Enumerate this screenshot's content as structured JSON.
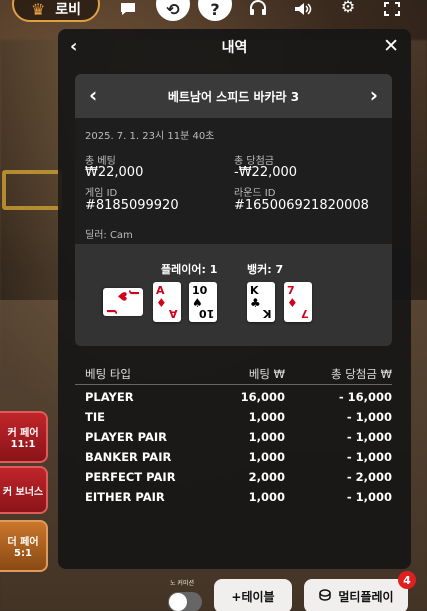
{
  "topbar": {
    "lobby_label": "로비",
    "icons": [
      "crown-icon",
      "chat-icon",
      "history-icon",
      "help-icon",
      "headset-icon",
      "volume-icon",
      "settings-icon",
      "fullscreen-icon"
    ]
  },
  "side_bets": {
    "item1_label": "커 페어",
    "item1_odds": "11:1",
    "item2_label": "커 보너스",
    "item3_label": "더 페어",
    "item3_odds": "5:1"
  },
  "panel": {
    "title": "내역",
    "game_name": "베트남어 스피드 바카라 3",
    "timestamp": "2025. 7. 1. 23시 11분 40초",
    "total_bet_label": "총 베팅",
    "total_bet_value": "₩22,000",
    "total_win_label": "총 당첨금",
    "total_win_value": "-₩22,000",
    "game_id_label": "게임 ID",
    "game_id_value": "#8185099920",
    "round_id_label": "라운드 ID",
    "round_id_value": "#165006921820008",
    "dealer_text": "딜러: Cam",
    "player_label": "플레이어: 1",
    "banker_label": "뱅커: 7",
    "player_cards": [
      {
        "rank": "J",
        "suit": "♥",
        "color": "#d0021b"
      },
      {
        "rank": "A",
        "suit": "♦",
        "color": "#d0021b"
      },
      {
        "rank": "10",
        "suit": "♠",
        "color": "#000000"
      }
    ],
    "banker_cards": [
      {
        "rank": "K",
        "suit": "♣",
        "color": "#000000"
      },
      {
        "rank": "7",
        "suit": "♦",
        "color": "#d0021b"
      }
    ],
    "bets_header": {
      "type": "베팅 타입",
      "bet": "베팅 ₩",
      "win": "총 당첨금 ₩"
    },
    "bets": [
      {
        "type": "PLAYER",
        "bet": "16,000",
        "win": "- 16,000"
      },
      {
        "type": "TIE",
        "bet": "1,000",
        "win": "- 1,000"
      },
      {
        "type": "PLAYER PAIR",
        "bet": "1,000",
        "win": "- 1,000"
      },
      {
        "type": "BANKER PAIR",
        "bet": "1,000",
        "win": "- 1,000"
      },
      {
        "type": "PERFECT PAIR",
        "bet": "2,000",
        "win": "- 2,000"
      },
      {
        "type": "EITHER PAIR",
        "bet": "1,000",
        "win": "- 1,000"
      }
    ]
  },
  "bottom": {
    "toggle_label": "노 커미션",
    "add_table_label": "+테이블",
    "multiplay_label": "멀티플레이",
    "multiplay_badge": "4"
  },
  "colors": {
    "accent_orange": "#e0a040",
    "red": "#d0021b",
    "panel_bg": "#161616"
  }
}
